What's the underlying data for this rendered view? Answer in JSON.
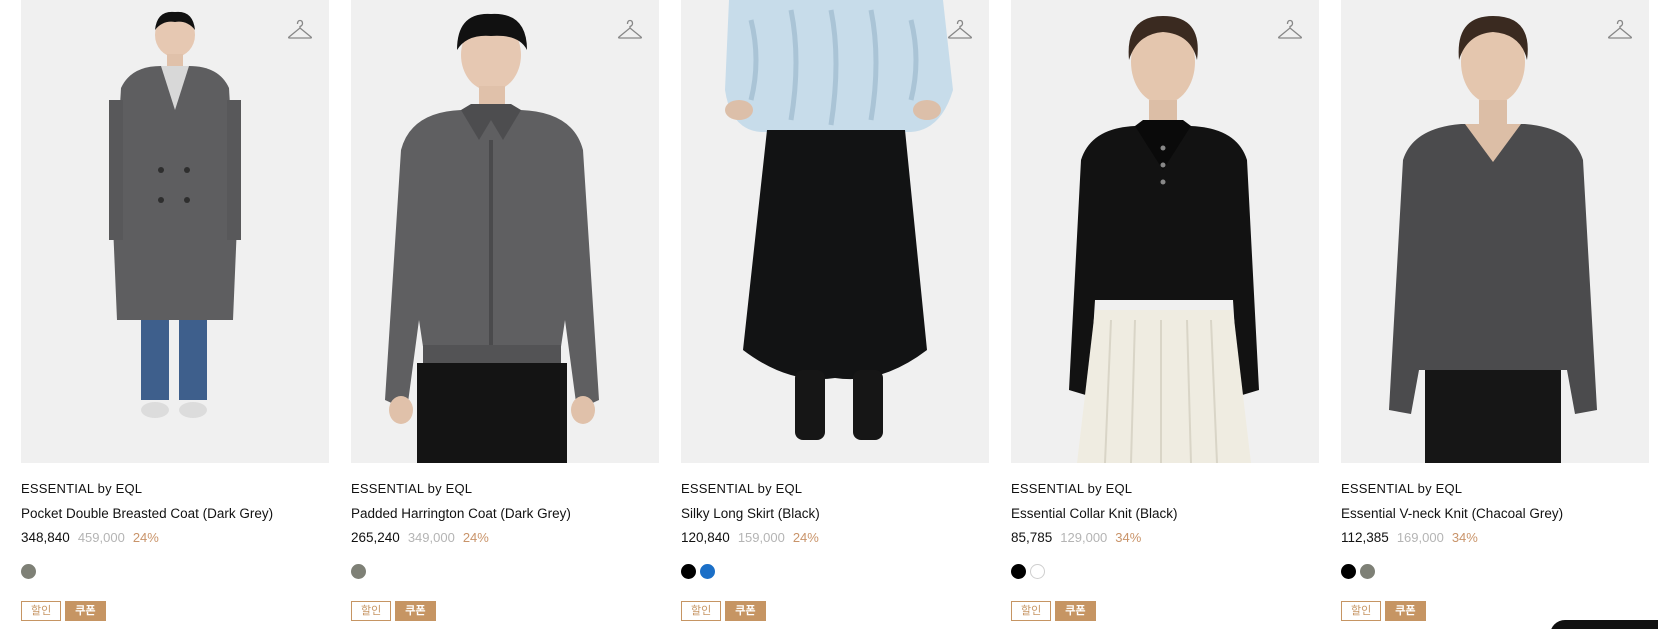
{
  "colors": {
    "accent": "#c69563",
    "discount": "#c9946a",
    "original_price": "#b4b4b4",
    "card_bg": "#f0f0f0"
  },
  "products": [
    {
      "brand": "ESSENTIAL by EQL",
      "name": "Pocket Double Breasted Coat (Dark Grey)",
      "price": "348,840",
      "original_price": "459,000",
      "discount": "24%",
      "swatches": [
        "#7e8076"
      ],
      "tags": [
        "할인",
        "쿠폰"
      ],
      "icon": "hanger-icon"
    },
    {
      "brand": "ESSENTIAL by EQL",
      "name": "Padded Harrington Coat (Dark Grey)",
      "price": "265,240",
      "original_price": "349,000",
      "discount": "24%",
      "swatches": [
        "#7e8076"
      ],
      "tags": [
        "할인",
        "쿠폰"
      ],
      "icon": "hanger-icon"
    },
    {
      "brand": "ESSENTIAL by EQL",
      "name": "Silky Long Skirt (Black)",
      "price": "120,840",
      "original_price": "159,000",
      "discount": "24%",
      "swatches": [
        "#000000",
        "#1b6fc7"
      ],
      "tags": [
        "할인",
        "쿠폰"
      ],
      "icon": "hanger-icon"
    },
    {
      "brand": "ESSENTIAL by EQL",
      "name": "Essential Collar Knit (Black)",
      "price": "85,785",
      "original_price": "129,000",
      "discount": "34%",
      "swatches": [
        "#000000",
        "#ffffff"
      ],
      "tags": [
        "할인",
        "쿠폰"
      ],
      "icon": "hanger-icon"
    },
    {
      "brand": "ESSENTIAL by EQL",
      "name": "Essential V-neck Knit (Chacoal Grey)",
      "price": "112,385",
      "original_price": "169,000",
      "discount": "34%",
      "swatches": [
        "#000000",
        "#7e8076"
      ],
      "tags": [
        "할인",
        "쿠폰"
      ],
      "icon": "hanger-icon"
    }
  ]
}
